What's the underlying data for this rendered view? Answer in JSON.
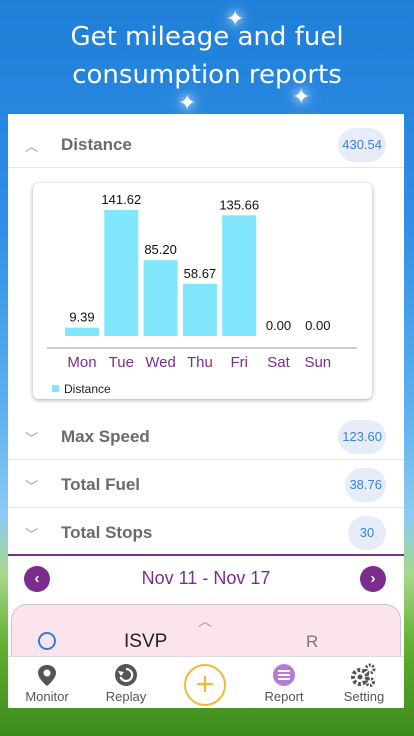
{
  "headline": {
    "line1": "Get mileage and fuel",
    "line2": "consumption reports"
  },
  "rows": {
    "distance": {
      "label": "Distance",
      "value": "430.54"
    },
    "max_speed": {
      "label": "Max Speed",
      "value": "123.60"
    },
    "total_fuel": {
      "label": "Total Fuel",
      "value": "38.76"
    },
    "total_stops": {
      "label": "Total Stops",
      "value": "30"
    }
  },
  "chart_data": {
    "type": "bar",
    "categories": [
      "Mon",
      "Tue",
      "Wed",
      "Thu",
      "Fri",
      "Sat",
      "Sun"
    ],
    "series": [
      {
        "name": "Distance",
        "values": [
          9.39,
          141.62,
          85.2,
          58.67,
          135.66,
          0.0,
          0.0
        ]
      }
    ],
    "value_labels": [
      "9.39",
      "141.62",
      "85.20",
      "58.67",
      "135.66",
      "0.00",
      "0.00"
    ],
    "legend": "bottom-left",
    "bar_color": "#80e6fb",
    "category_color": "#7b2d8e"
  },
  "date_range": "Nov 11 - Nov 17",
  "nav": {
    "prev": "‹",
    "next": "›"
  },
  "vehicle_panel": {
    "name": "ISVP",
    "tag": "R"
  },
  "tabs": [
    {
      "label": "Monitor",
      "icon": "map-pin-icon"
    },
    {
      "label": "Replay",
      "icon": "replay-icon"
    },
    {
      "label": "Report",
      "icon": "report-icon"
    },
    {
      "label": "Setting",
      "icon": "gears-icon"
    }
  ],
  "colors": {
    "accent": "#7b2d8e",
    "badge_text": "#3b82d8",
    "add_button": "#f0b93a",
    "report_active": "#b57bd9"
  }
}
